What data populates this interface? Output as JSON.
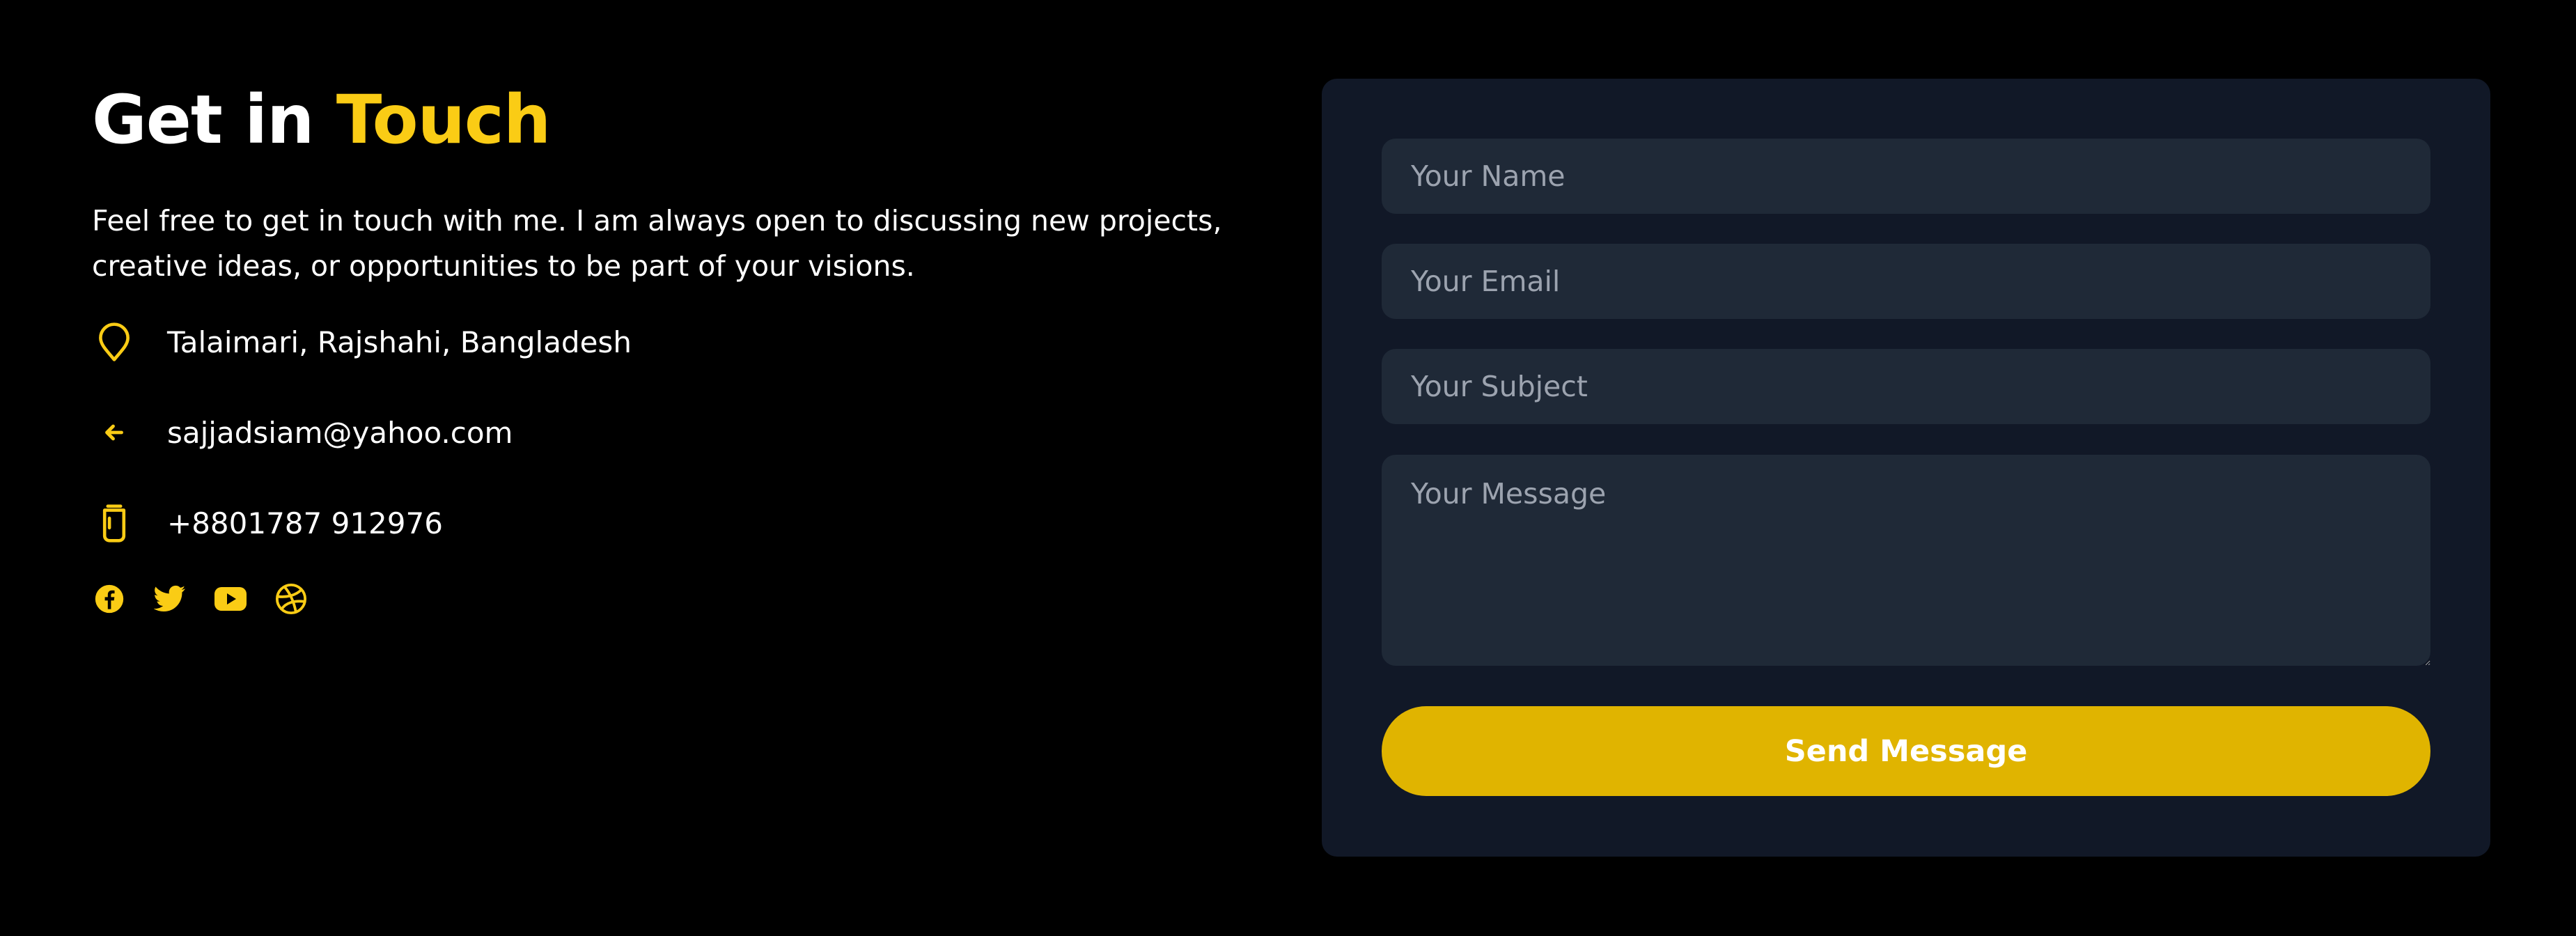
{
  "header": {
    "title_main": "Get in ",
    "title_accent": "Touch"
  },
  "intro": "Feel free to get in touch with me. I am always open to discussing new projects, creative ideas, or opportunities to be part of your visions.",
  "contact": {
    "location": {
      "icon": "map-pin-icon",
      "text": "Talaimari, Rajshahi, Bangladesh"
    },
    "email": {
      "icon": "arrow-left-icon",
      "text": "sajjadsiam@yahoo.com"
    },
    "phone": {
      "icon": "phone-icon",
      "text": "+8801787 912976"
    }
  },
  "socials": [
    {
      "icon": "facebook-icon"
    },
    {
      "icon": "twitter-icon"
    },
    {
      "icon": "youtube-icon"
    },
    {
      "icon": "dribbble-icon"
    }
  ],
  "form": {
    "name_placeholder": "Your Name",
    "email_placeholder": "Your Email",
    "subject_placeholder": "Your Subject",
    "message_placeholder": "Your Message",
    "submit_label": "Send Message"
  },
  "colors": {
    "accent": "#facc15",
    "button": "#e0b400",
    "card_bg": "#111827",
    "input_bg": "#1f2937",
    "page_bg": "#000000"
  }
}
